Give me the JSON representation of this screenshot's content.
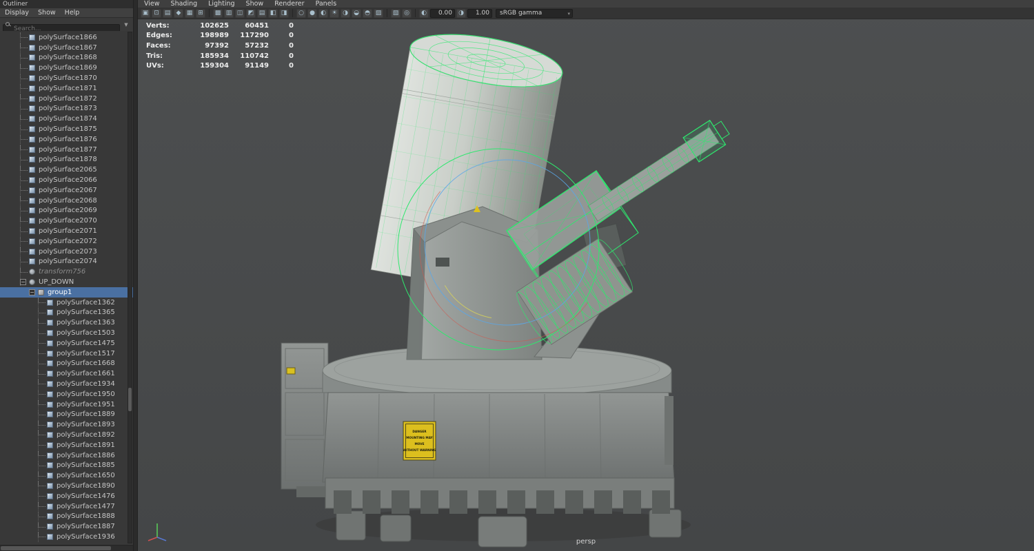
{
  "colors": {
    "selection_green": "#2ee86e",
    "selection_highlight_blue": "#4a70a2",
    "placard_yellow": "#dcbf1e"
  },
  "outliner": {
    "title": "Outliner",
    "menus": [
      "Display",
      "Show",
      "Help"
    ],
    "search": {
      "placeholder": "Search..."
    },
    "items": [
      {
        "name": "polySurface1866",
        "depth": 1,
        "type": "mesh"
      },
      {
        "name": "polySurface1867",
        "depth": 1,
        "type": "mesh"
      },
      {
        "name": "polySurface1868",
        "depth": 1,
        "type": "mesh"
      },
      {
        "name": "polySurface1869",
        "depth": 1,
        "type": "mesh"
      },
      {
        "name": "polySurface1870",
        "depth": 1,
        "type": "mesh"
      },
      {
        "name": "polySurface1871",
        "depth": 1,
        "type": "mesh"
      },
      {
        "name": "polySurface1872",
        "depth": 1,
        "type": "mesh"
      },
      {
        "name": "polySurface1873",
        "depth": 1,
        "type": "mesh"
      },
      {
        "name": "polySurface1874",
        "depth": 1,
        "type": "mesh"
      },
      {
        "name": "polySurface1875",
        "depth": 1,
        "type": "mesh"
      },
      {
        "name": "polySurface1876",
        "depth": 1,
        "type": "mesh"
      },
      {
        "name": "polySurface1877",
        "depth": 1,
        "type": "mesh"
      },
      {
        "name": "polySurface1878",
        "depth": 1,
        "type": "mesh"
      },
      {
        "name": "polySurface2065",
        "depth": 1,
        "type": "mesh"
      },
      {
        "name": "polySurface2066",
        "depth": 1,
        "type": "mesh"
      },
      {
        "name": "polySurface2067",
        "depth": 1,
        "type": "mesh"
      },
      {
        "name": "polySurface2068",
        "depth": 1,
        "type": "mesh"
      },
      {
        "name": "polySurface2069",
        "depth": 1,
        "type": "mesh"
      },
      {
        "name": "polySurface2070",
        "depth": 1,
        "type": "mesh"
      },
      {
        "name": "polySurface2071",
        "depth": 1,
        "type": "mesh"
      },
      {
        "name": "polySurface2072",
        "depth": 1,
        "type": "mesh"
      },
      {
        "name": "polySurface2073",
        "depth": 1,
        "type": "mesh"
      },
      {
        "name": "polySurface2074",
        "depth": 1,
        "type": "mesh"
      },
      {
        "name": "transform756",
        "depth": 1,
        "type": "transform",
        "muted": true
      },
      {
        "name": "UP_DOWN",
        "depth": 1,
        "type": "transform",
        "expander": true
      },
      {
        "name": "group1",
        "depth": 2,
        "type": "group",
        "expander": true,
        "selected": true
      },
      {
        "name": "polySurface1362",
        "depth": 3,
        "type": "mesh"
      },
      {
        "name": "polySurface1365",
        "depth": 3,
        "type": "mesh"
      },
      {
        "name": "polySurface1363",
        "depth": 3,
        "type": "mesh"
      },
      {
        "name": "polySurface1503",
        "depth": 3,
        "type": "mesh"
      },
      {
        "name": "polySurface1475",
        "depth": 3,
        "type": "mesh"
      },
      {
        "name": "polySurface1517",
        "depth": 3,
        "type": "mesh"
      },
      {
        "name": "polySurface1668",
        "depth": 3,
        "type": "mesh"
      },
      {
        "name": "polySurface1661",
        "depth": 3,
        "type": "mesh"
      },
      {
        "name": "polySurface1934",
        "depth": 3,
        "type": "mesh"
      },
      {
        "name": "polySurface1950",
        "depth": 3,
        "type": "mesh"
      },
      {
        "name": "polySurface1951",
        "depth": 3,
        "type": "mesh"
      },
      {
        "name": "polySurface1889",
        "depth": 3,
        "type": "mesh"
      },
      {
        "name": "polySurface1893",
        "depth": 3,
        "type": "mesh"
      },
      {
        "name": "polySurface1892",
        "depth": 3,
        "type": "mesh"
      },
      {
        "name": "polySurface1891",
        "depth": 3,
        "type": "mesh"
      },
      {
        "name": "polySurface1886",
        "depth": 3,
        "type": "mesh"
      },
      {
        "name": "polySurface1885",
        "depth": 3,
        "type": "mesh"
      },
      {
        "name": "polySurface1650",
        "depth": 3,
        "type": "mesh"
      },
      {
        "name": "polySurface1890",
        "depth": 3,
        "type": "mesh"
      },
      {
        "name": "polySurface1476",
        "depth": 3,
        "type": "mesh"
      },
      {
        "name": "polySurface1477",
        "depth": 3,
        "type": "mesh"
      },
      {
        "name": "polySurface1888",
        "depth": 3,
        "type": "mesh"
      },
      {
        "name": "polySurface1887",
        "depth": 3,
        "type": "mesh"
      },
      {
        "name": "polySurface1936",
        "depth": 3,
        "type": "mesh"
      }
    ]
  },
  "viewport": {
    "menus": [
      "View",
      "Shading",
      "Lighting",
      "Show",
      "Renderer",
      "Panels"
    ],
    "toolbar": {
      "icons": [
        {
          "name": "select-camera-icon",
          "glyph": "▣"
        },
        {
          "name": "lock-camera-icon",
          "glyph": "⊡"
        },
        {
          "name": "camera-attributes-icon",
          "glyph": "▤"
        },
        {
          "name": "bookmarks-icon",
          "glyph": "◆"
        },
        {
          "name": "image-plane-icon",
          "glyph": "▦"
        },
        {
          "name": "pan-zoom-icon",
          "glyph": "⊞"
        },
        {
          "name": "separator"
        },
        {
          "name": "grid-icon",
          "glyph": "▩"
        },
        {
          "name": "film-gate-icon",
          "glyph": "▥"
        },
        {
          "name": "resolution-gate-icon",
          "glyph": "◫"
        },
        {
          "name": "gate-mask-icon",
          "glyph": "◩"
        },
        {
          "name": "field-chart-icon",
          "glyph": "▤"
        },
        {
          "name": "safe-action-icon",
          "glyph": "◧"
        },
        {
          "name": "safe-title-icon",
          "glyph": "◨"
        },
        {
          "name": "separator"
        },
        {
          "name": "wireframe-icon",
          "glyph": "○"
        },
        {
          "name": "shaded-icon",
          "glyph": "●"
        },
        {
          "name": "textured-icon",
          "glyph": "◐"
        },
        {
          "name": "use-all-lights-icon",
          "glyph": "☀"
        },
        {
          "name": "shadows-icon",
          "glyph": "◑"
        },
        {
          "name": "ambient-occlusion-icon",
          "glyph": "◒"
        },
        {
          "name": "motion-blur-icon",
          "glyph": "◓"
        },
        {
          "name": "anti-aliasing-icon",
          "glyph": "▨"
        },
        {
          "name": "separator"
        },
        {
          "name": "xray-icon",
          "glyph": "▧"
        },
        {
          "name": "isolate-select-icon",
          "glyph": "◎"
        },
        {
          "name": "separator"
        }
      ],
      "exposure_icon_glyph": "◐",
      "exposure_value": "0.00",
      "gamma_icon_glyph": "◑",
      "gamma_value": "1.00",
      "view_transform": "sRGB gamma",
      "dropdown_arrow": "▾"
    },
    "hud": {
      "rows": [
        {
          "label": "Verts:",
          "counts": [
            "102625",
            "60451",
            "0"
          ]
        },
        {
          "label": "Edges:",
          "counts": [
            "198989",
            "117290",
            "0"
          ]
        },
        {
          "label": "Faces:",
          "counts": [
            "97392",
            "57232",
            "0"
          ]
        },
        {
          "label": "Tris:",
          "counts": [
            "185934",
            "110742",
            "0"
          ]
        },
        {
          "label": "UVs:",
          "counts": [
            "159304",
            "91149",
            "0"
          ]
        }
      ]
    },
    "placard_lines": [
      "DANGER",
      "MOUNTING MAY",
      "MOVE",
      "WITHOUT WARNING"
    ],
    "camera_label": "persp"
  }
}
